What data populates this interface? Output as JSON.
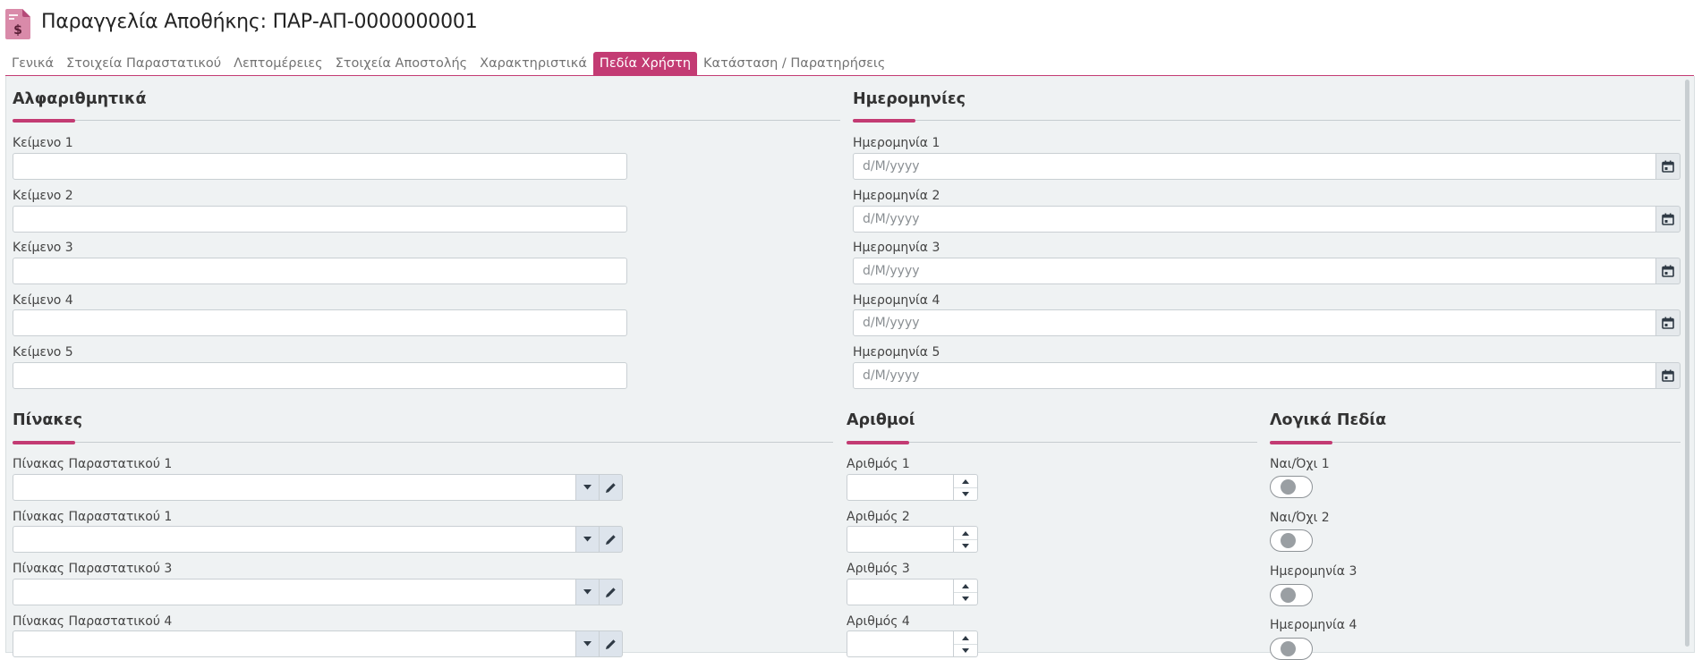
{
  "header": {
    "title": "Παραγγελία Αποθήκης: ΠΑΡ-ΑΠ-0000000001",
    "icon": "document-dollar-icon",
    "accent_color": "#c33b73"
  },
  "tabs": [
    {
      "label": "Γενικά",
      "active": false
    },
    {
      "label": "Στοιχεία Παραστατικού",
      "active": false
    },
    {
      "label": "Λεπτομέρειες",
      "active": false
    },
    {
      "label": "Στοιχεία Αποστολής",
      "active": false
    },
    {
      "label": "Χαρακτηριστικά",
      "active": false
    },
    {
      "label": "Πεδία Χρήστη",
      "active": true
    },
    {
      "label": "Κατάσταση / Παρατηρήσεις",
      "active": false
    }
  ],
  "alphanumeric": {
    "title": "Αλφαριθμητικά",
    "fields": [
      {
        "label": "Κείμενο 1",
        "value": ""
      },
      {
        "label": "Κείμενο 2",
        "value": ""
      },
      {
        "label": "Κείμενο 3",
        "value": ""
      },
      {
        "label": "Κείμενο 4",
        "value": ""
      },
      {
        "label": "Κείμενο 5",
        "value": ""
      }
    ]
  },
  "dates": {
    "title": "Ημερομηνίες",
    "fields": [
      {
        "label": "Ημερομηνία 1",
        "placeholder": "d/M/yyyy",
        "value": ""
      },
      {
        "label": "Ημερομηνία 2",
        "placeholder": "d/M/yyyy",
        "value": ""
      },
      {
        "label": "Ημερομηνία 3",
        "placeholder": "d/M/yyyy",
        "value": ""
      },
      {
        "label": "Ημερομηνία 4",
        "placeholder": "d/M/yyyy",
        "value": ""
      },
      {
        "label": "Ημερομηνία 5",
        "placeholder": "d/M/yyyy",
        "value": ""
      }
    ]
  },
  "tables": {
    "title": "Πίνακες",
    "fields": [
      {
        "label": "Πίνακας Παραστατικού 1",
        "value": ""
      },
      {
        "label": "Πίνακας Παραστατικού 1",
        "value": ""
      },
      {
        "label": "Πίνακας Παραστατικού 3",
        "value": ""
      },
      {
        "label": "Πίνακας Παραστατικού 4",
        "value": ""
      }
    ]
  },
  "numbers": {
    "title": "Αριθμοί",
    "fields": [
      {
        "label": "Αριθμός 1",
        "value": ""
      },
      {
        "label": "Αριθμός 2",
        "value": ""
      },
      {
        "label": "Αριθμός 3",
        "value": ""
      },
      {
        "label": "Αριθμός 4",
        "value": ""
      }
    ]
  },
  "booleans": {
    "title": "Λογικά Πεδία",
    "fields": [
      {
        "label": "Ναι/Όχι 1",
        "checked": false
      },
      {
        "label": "Ναι/Όχι 2",
        "checked": false
      },
      {
        "label": "Ημερομηνία 3",
        "checked": false
      },
      {
        "label": "Ημερομηνία 4",
        "checked": false
      }
    ]
  }
}
